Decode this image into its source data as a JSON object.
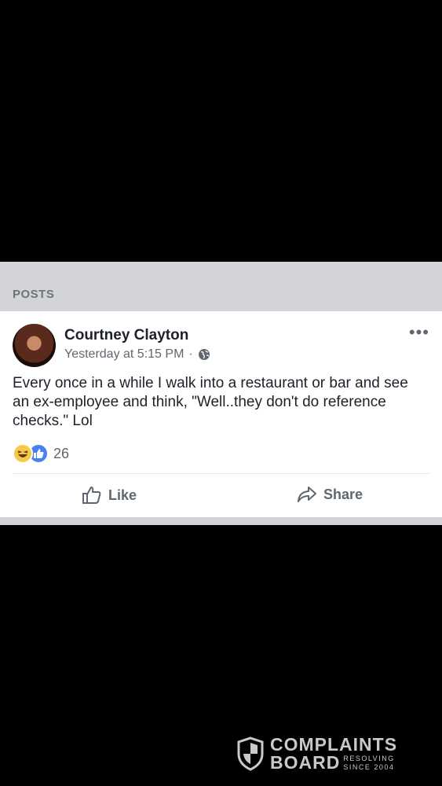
{
  "section": {
    "title": "POSTS"
  },
  "post": {
    "author": "Courtney Clayton",
    "timestamp": "Yesterday at 5:15 PM",
    "separator": "·",
    "text": "Every once in a while I walk into a restaurant or bar and see an ex-employee and think, \"Well..they don't do reference checks.\" Lol",
    "reaction_count": "26",
    "reaction_icons": [
      "haha-icon",
      "like-reaction-icon"
    ],
    "more_label": "•••",
    "actions": {
      "like": "Like",
      "share": "Share"
    }
  },
  "watermark": {
    "line1": "COMPLAINTS",
    "line2": "BOARD",
    "tag1": "RESOLVING",
    "tag2": "SINCE 2004"
  },
  "colors": {
    "header_bg": "#d3d4d8",
    "text": "#1d2129",
    "muted": "#606770",
    "like_blue": "#4a7ff0"
  }
}
